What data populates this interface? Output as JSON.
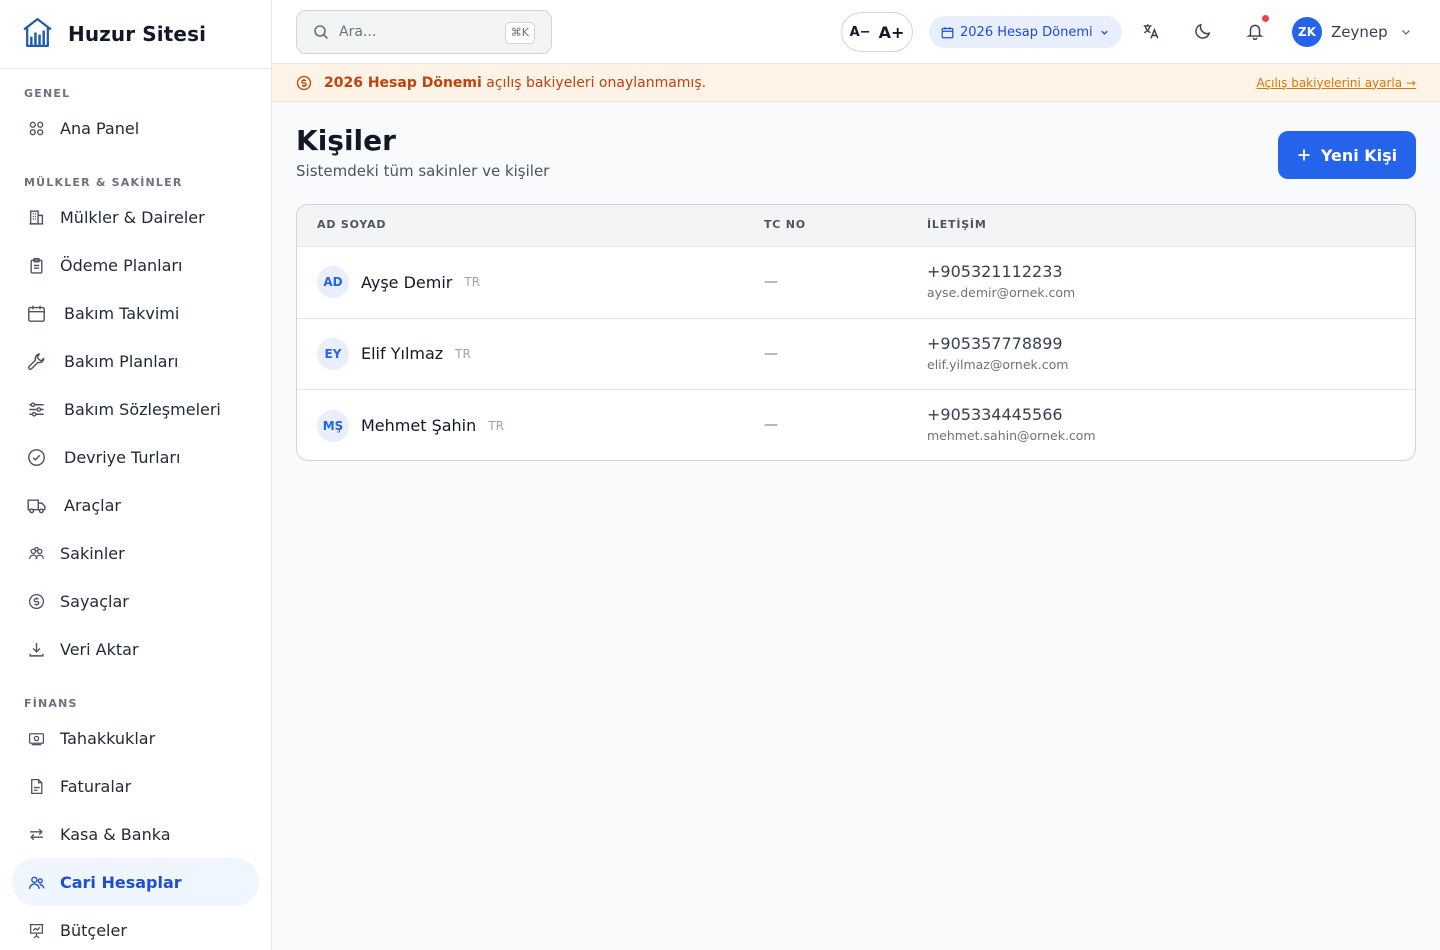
{
  "brand": {
    "name": "Huzur Sitesi"
  },
  "sidebar": {
    "sections": [
      {
        "label": "GENEL",
        "items": [
          {
            "label": "Ana Panel",
            "icon": "grid-icon"
          }
        ]
      },
      {
        "label": "MÜLKLER & SAKİNLER",
        "items": [
          {
            "label": "Mülkler & Daireler",
            "icon": "building-icon"
          },
          {
            "label": "Ödeme Planları",
            "icon": "clipboard-icon"
          },
          {
            "label": "Bakım Takvimi",
            "icon": "calendar-icon"
          },
          {
            "label": "Bakım Planları",
            "icon": "wrench-icon"
          },
          {
            "label": "Bakım Sözleşmeleri",
            "icon": "sliders-icon"
          },
          {
            "label": "Devriye Turları",
            "icon": "check-circle-icon"
          },
          {
            "label": "Araçlar",
            "icon": "truck-icon"
          },
          {
            "label": "Sakinler",
            "icon": "residents-icon"
          },
          {
            "label": "Sayaçlar",
            "icon": "dollar-circle-icon"
          },
          {
            "label": "Veri Aktar",
            "icon": "download-icon"
          }
        ]
      },
      {
        "label": "FİNANS",
        "items": [
          {
            "label": "Tahakkuklar",
            "icon": "banknote-icon"
          },
          {
            "label": "Faturalar",
            "icon": "invoice-icon"
          },
          {
            "label": "Kasa & Banka",
            "icon": "transfer-icon"
          },
          {
            "label": "Cari Hesaplar",
            "icon": "users-icon",
            "active": true
          },
          {
            "label": "Bütçeler",
            "icon": "presentation-icon"
          }
        ]
      }
    ]
  },
  "header": {
    "search_placeholder": "Ara...",
    "search_shortcut": "⌘K",
    "font_decrease": "A−",
    "font_increase": "A+",
    "period_label": "2026 Hesap Dönemi",
    "user_initials": "ZK",
    "user_name": "Zeynep"
  },
  "alert": {
    "strong": "2026 Hesap Dönemi",
    "text": " açılış bakiyeleri onaylanmamış.",
    "link": "Açılış bakiyelerini ayarla →"
  },
  "page": {
    "title": "Kişiler",
    "subtitle": "Sistemdeki tüm sakinler ve kişiler",
    "new_button": "Yeni Kişi"
  },
  "table": {
    "headers": {
      "name": "AD SOYAD",
      "tc": "TC NO",
      "contact": "İLETİŞİM"
    },
    "rows": [
      {
        "initials": "AD",
        "name": "Ayşe Demir",
        "nationality": "TR",
        "tc": "—",
        "phone": "+905321112233",
        "email": "ayse.demir@ornek.com"
      },
      {
        "initials": "EY",
        "name": "Elif Yılmaz",
        "nationality": "TR",
        "tc": "—",
        "phone": "+905357778899",
        "email": "elif.yilmaz@ornek.com"
      },
      {
        "initials": "MŞ",
        "name": "Mehmet Şahin",
        "nationality": "TR",
        "tc": "—",
        "phone": "+905334445566",
        "email": "mehmet.sahin@ornek.com"
      }
    ]
  },
  "colors": {
    "accent": "#2563eb",
    "alert_text": "#c2410c",
    "alert_bg": "#fdf3e6"
  }
}
